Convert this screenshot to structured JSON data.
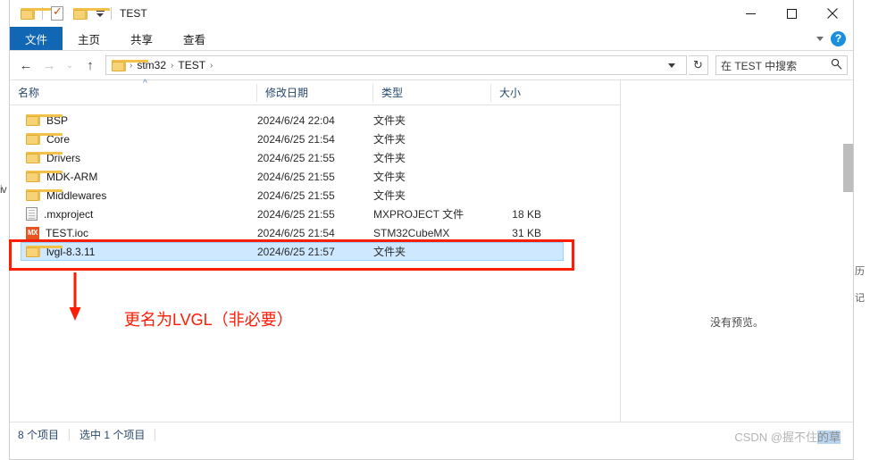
{
  "window": {
    "title": "TEST",
    "quick_access": [
      {
        "name": "folder-icon",
        "label": ""
      },
      {
        "name": "properties-icon",
        "label": ""
      },
      {
        "name": "new-folder-icon",
        "label": ""
      },
      {
        "name": "customize-caret-icon",
        "label": ""
      }
    ],
    "controls": {
      "minimize": "–",
      "maximize": "□",
      "close": "✕"
    }
  },
  "ribbon": {
    "tabs": [
      {
        "label": "文件",
        "active": true
      },
      {
        "label": "主页",
        "active": false
      },
      {
        "label": "共享",
        "active": false
      },
      {
        "label": "查看",
        "active": false
      }
    ],
    "collapse_icon": "chevron-down-icon",
    "help_label": "?"
  },
  "addressbar": {
    "back": "←",
    "forward": "→",
    "recent": "⌄",
    "up": "↑",
    "crumbs": [
      "stm32",
      "TEST"
    ],
    "separator": "›",
    "refresh": "↻"
  },
  "search": {
    "placeholder": "在 TEST 中搜索",
    "value": "在 TEST 中搜索",
    "icon": "search-icon"
  },
  "columns": [
    {
      "key": "name",
      "label": "名称"
    },
    {
      "key": "date",
      "label": "修改日期"
    },
    {
      "key": "type",
      "label": "类型"
    },
    {
      "key": "size",
      "label": "大小"
    }
  ],
  "rows": [
    {
      "icon": "folder-icon",
      "name": "BSP",
      "date": "2024/6/24 22:04",
      "type": "文件夹",
      "size": "",
      "selected": false
    },
    {
      "icon": "folder-icon",
      "name": "Core",
      "date": "2024/6/25 21:54",
      "type": "文件夹",
      "size": "",
      "selected": false
    },
    {
      "icon": "folder-icon",
      "name": "Drivers",
      "date": "2024/6/25 21:55",
      "type": "文件夹",
      "size": "",
      "selected": false
    },
    {
      "icon": "folder-icon",
      "name": "MDK-ARM",
      "date": "2024/6/25 21:55",
      "type": "文件夹",
      "size": "",
      "selected": false
    },
    {
      "icon": "folder-icon",
      "name": "Middlewares",
      "date": "2024/6/25 21:55",
      "type": "文件夹",
      "size": "",
      "selected": false
    },
    {
      "icon": "mxproject-icon",
      "name": ".mxproject",
      "date": "2024/6/25 21:55",
      "type": "MXPROJECT 文件",
      "size": "18 KB",
      "selected": false
    },
    {
      "icon": "ioc-icon",
      "name": "TEST.ioc",
      "date": "2024/6/25 21:54",
      "type": "STM32CubeMX",
      "size": "31 KB",
      "selected": false
    },
    {
      "icon": "folder-icon",
      "name": "lvgl-8.3.11",
      "date": "2024/6/25 21:57",
      "type": "文件夹",
      "size": "",
      "selected": true
    }
  ],
  "preview": {
    "message": "没有预览。"
  },
  "statusbar": {
    "count": "8 个项目",
    "selected": "选中 1 个项目"
  },
  "watermark": {
    "prefix": "CSDN @握不住",
    "highlight": "的草"
  },
  "annotation": {
    "text": "更名为LVGL（非必要）",
    "color": "#fc1d05"
  },
  "background": {
    "left_fragment": "iv",
    "right_fragment_1": "历",
    "right_fragment_2": "记"
  }
}
